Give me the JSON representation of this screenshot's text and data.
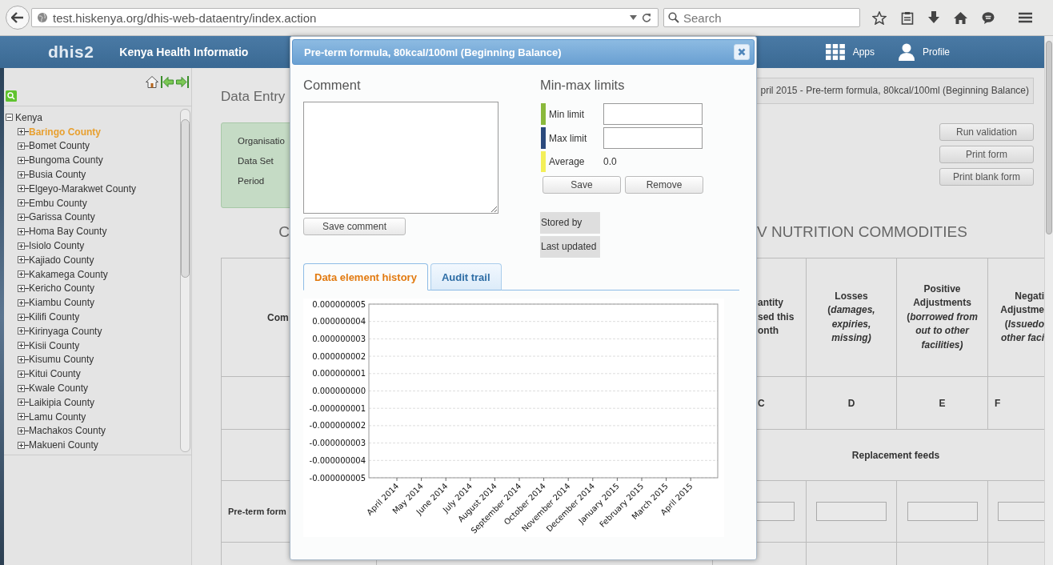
{
  "browser": {
    "url": "test.hiskenya.org/dhis-web-dataentry/index.action",
    "search": {
      "placeholder": "Search"
    }
  },
  "header": {
    "logo": "dhis2",
    "title": "Kenya Health Informatio",
    "menu": [
      {
        "label": "Apps",
        "kind": "apps"
      },
      {
        "label": "Profile",
        "kind": "profile"
      }
    ]
  },
  "sidebar": {
    "tree": {
      "label": "Kenya",
      "expanded": true,
      "selected": false,
      "children": [
        {
          "label": "Baringo County",
          "expanded": false,
          "selected": true
        },
        {
          "label": "Bomet County",
          "expanded": false,
          "selected": false
        },
        {
          "label": "Bungoma County",
          "expanded": false,
          "selected": false
        },
        {
          "label": "Busia County",
          "expanded": false,
          "selected": false
        },
        {
          "label": "Elgeyo-Marakwet County",
          "expanded": false,
          "selected": false
        },
        {
          "label": "Embu County",
          "expanded": false,
          "selected": false
        },
        {
          "label": "Garissa County",
          "expanded": false,
          "selected": false
        },
        {
          "label": "Homa Bay County",
          "expanded": false,
          "selected": false
        },
        {
          "label": "Isiolo County",
          "expanded": false,
          "selected": false
        },
        {
          "label": "Kajiado County",
          "expanded": false,
          "selected": false
        },
        {
          "label": "Kakamega County",
          "expanded": false,
          "selected": false
        },
        {
          "label": "Kericho County",
          "expanded": false,
          "selected": false
        },
        {
          "label": "Kiambu County",
          "expanded": false,
          "selected": false
        },
        {
          "label": "Kilifi County",
          "expanded": false,
          "selected": false
        },
        {
          "label": "Kirinyaga County",
          "expanded": false,
          "selected": false
        },
        {
          "label": "Kisii County",
          "expanded": false,
          "selected": false
        },
        {
          "label": "Kisumu County",
          "expanded": false,
          "selected": false
        },
        {
          "label": "Kitui County",
          "expanded": false,
          "selected": false
        },
        {
          "label": "Kwale County",
          "expanded": false,
          "selected": false
        },
        {
          "label": "Laikipia County",
          "expanded": false,
          "selected": false
        },
        {
          "label": "Lamu County",
          "expanded": false,
          "selected": false
        },
        {
          "label": "Machakos County",
          "expanded": false,
          "selected": false
        },
        {
          "label": "Makueni County",
          "expanded": false,
          "selected": false
        }
      ]
    }
  },
  "main": {
    "title": "Data Entry",
    "form_labels": [
      "Organisatio",
      "Data Set",
      "Period"
    ],
    "context": "pril 2015 - Pre-term formula, 80kcal/100ml (Beginning Balance)",
    "buttons": [
      "Run validation",
      "Print form",
      "Print blank form"
    ],
    "heading_left": "C",
    "heading_right": "V NUTRITION COMMODITIES",
    "table": {
      "first_header": "Com",
      "headers": [
        {
          "lines": [
            "antity",
            "sed this",
            "onth"
          ]
        },
        {
          "lines": [
            "Losses",
            "(*damages,*",
            "*expiries,*",
            "*missing)*"
          ]
        },
        {
          "lines": [
            "Positive",
            "Adjustments",
            "(*borrowed from*",
            "*out to other*",
            "*facilities)*"
          ]
        },
        {
          "lines": [
            "Negati",
            "Adjustme",
            "(*Issuedo*",
            "*other faci*"
          ]
        }
      ],
      "letters": [
        "C",
        "D",
        "E",
        "F"
      ],
      "section": "Replacement feeds",
      "rows": [
        {
          "label": "Pre-term form"
        }
      ]
    }
  },
  "dialog": {
    "title": "Pre-term formula, 80kcal/100ml (Beginning Balance)",
    "comment": {
      "heading": "Comment",
      "button": "Save comment"
    },
    "limits": {
      "heading": "Min-max limits",
      "rows": [
        {
          "label": "Min limit",
          "kind": "input",
          "color": "#8ab93b"
        },
        {
          "label": "Max limit",
          "kind": "input",
          "color": "#2b4a7d"
        },
        {
          "label": "Average",
          "kind": "value",
          "value": "0.0",
          "color": "#f3ef58"
        }
      ],
      "buttons": [
        "Save",
        "Remove"
      ]
    },
    "info": [
      "Stored by",
      "Last updated"
    ],
    "tabs": [
      {
        "label": "Data element history",
        "selected": true
      },
      {
        "label": "Audit trail",
        "selected": false
      }
    ],
    "chart_data": {
      "type": "line",
      "grid": true,
      "categories": [
        "April 2014",
        "May 2014",
        "June 2014",
        "July 2014",
        "August 2014",
        "September 2014",
        "October 2014",
        "November 2014",
        "December 2014",
        "January 2015",
        "February 2015",
        "March 2015",
        "April 2015"
      ],
      "ylim": [
        -5e-09,
        5e-09
      ],
      "yticks": [
        {
          "value": 5e-09,
          "label": "0.000000005"
        },
        {
          "value": 4e-09,
          "label": "0.000000004"
        },
        {
          "value": 3e-09,
          "label": "0.000000003"
        },
        {
          "value": 2e-09,
          "label": "0.000000002"
        },
        {
          "value": 1e-09,
          "label": "0.000000001"
        },
        {
          "value": 0,
          "label": "0.000000000"
        },
        {
          "value": -1e-09,
          "label": "-0.000000001"
        },
        {
          "value": -2e-09,
          "label": "-0.000000002"
        },
        {
          "value": -3e-09,
          "label": "-0.000000003"
        },
        {
          "value": -4e-09,
          "label": "-0.000000004"
        },
        {
          "value": -5e-09,
          "label": "-0.000000005"
        }
      ]
    }
  }
}
